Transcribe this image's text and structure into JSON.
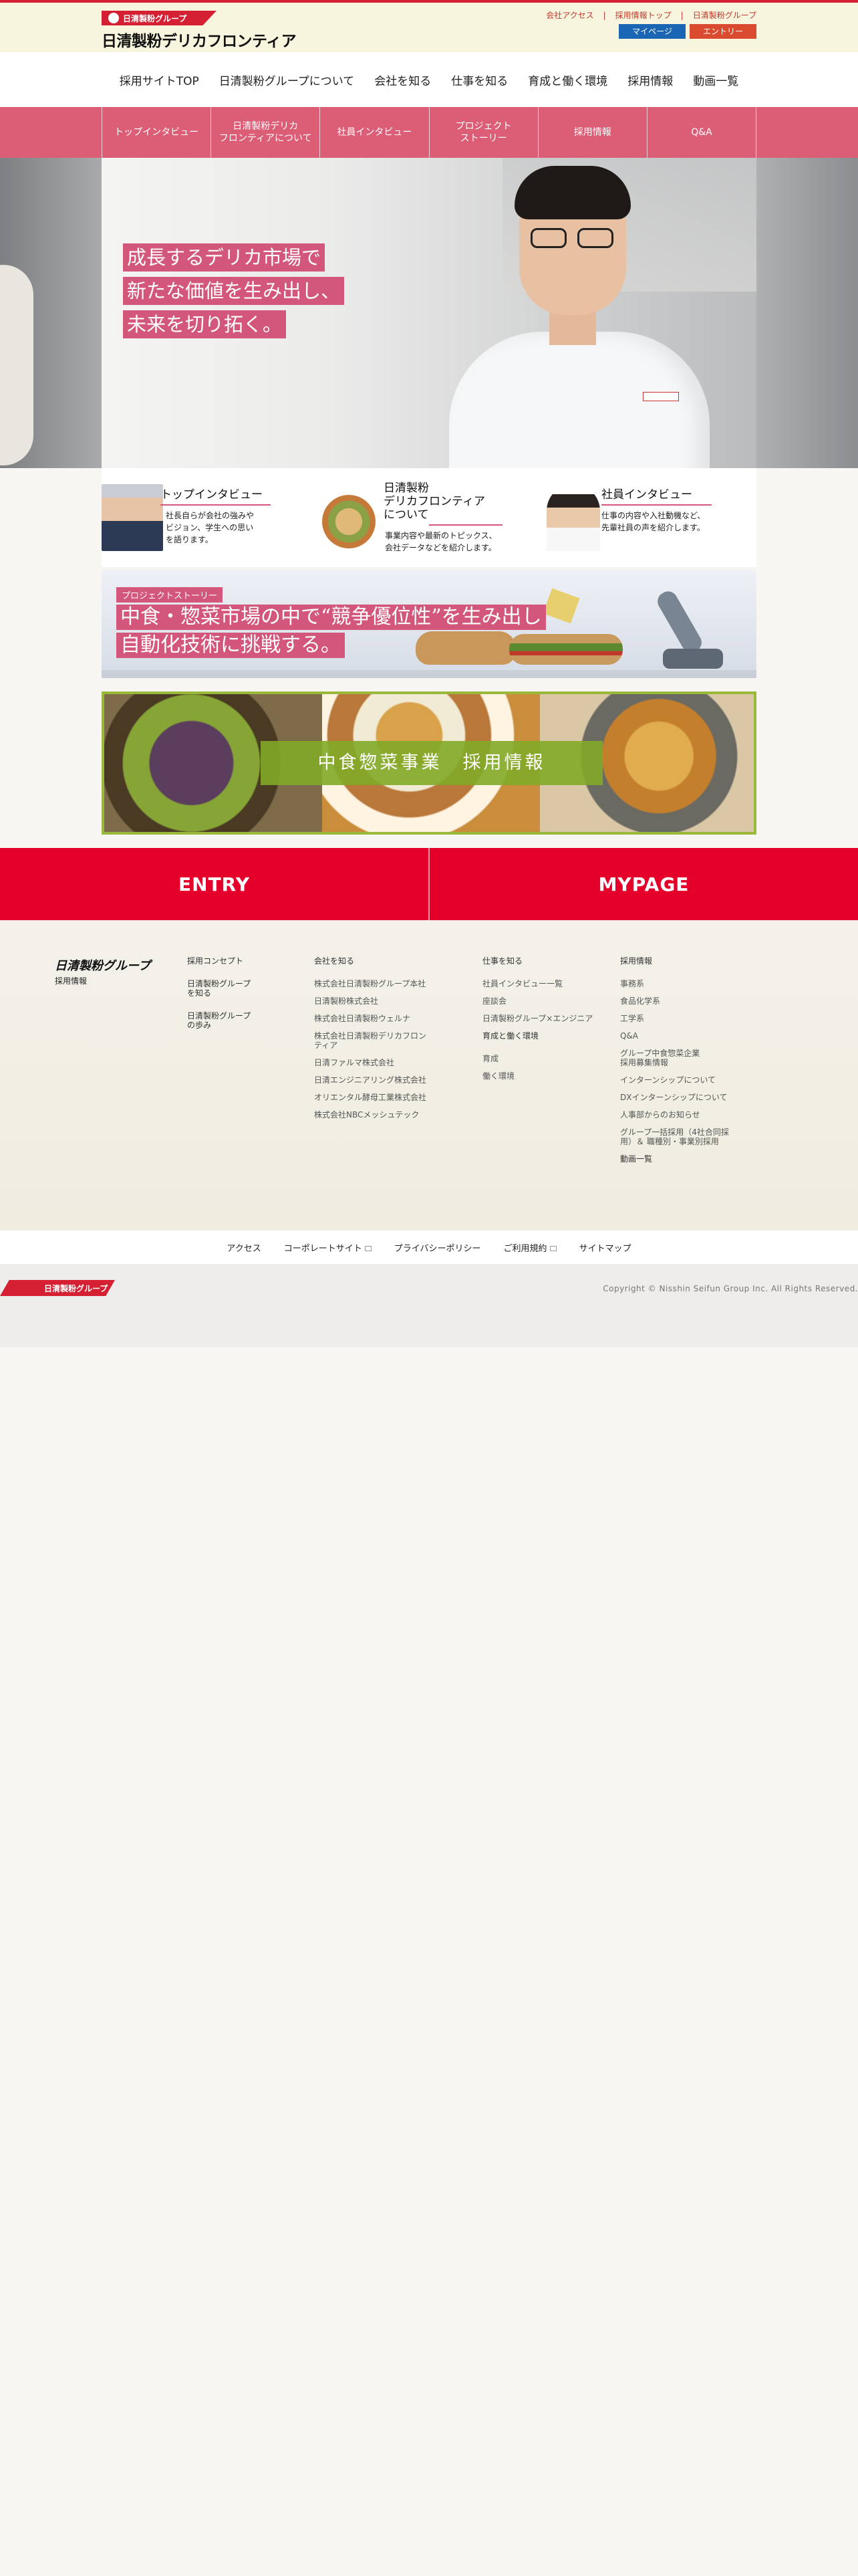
{
  "header": {
    "logo_badge": "日清製粉グループ",
    "logo_main": "日清製粉デリカフロンティア",
    "util_links": [
      "会社アクセス",
      "採用情報トップ",
      "日清製粉グループ"
    ],
    "mypage_btn": "マイページ",
    "entry_btn": "エントリー"
  },
  "gnav": [
    "採用サイトTOP",
    "日清製粉グループについて",
    "会社を知る",
    "仕事を知る",
    "育成と働く環境",
    "採用情報",
    "動画一覧"
  ],
  "subnav": [
    "トップインタビュー",
    "日清製粉デリカ\nフロンティアについて",
    "社員インタビュー",
    "プロジェクト\nストーリー",
    "採用情報",
    "Q&A"
  ],
  "hero": {
    "copy": [
      "成長するデリカ市場で",
      "新たな価値を生み出し、",
      "未来を切り拓く。"
    ]
  },
  "promo": {
    "items": [
      {
        "title": "トップインタビュー",
        "desc": [
          "社長自らが会社の強みや",
          "ビジョン、学生への思い",
          "を語ります。"
        ]
      },
      {
        "title": [
          "日清製粉",
          "デリカフロンティア",
          "について"
        ],
        "desc": [
          "事業内容や最新のトピックス、",
          "会社データなどを紹介します。"
        ]
      },
      {
        "title": "社員インタビュー",
        "desc": [
          "仕事の内容や入社動機など、",
          "先輩社員の声を紹介します。"
        ]
      }
    ]
  },
  "banner": {
    "label": "プロジェクトストーリー",
    "line1": "中食・惣菜市場の中で“競争優位性”を生み出し",
    "line2": "自動化技術に挑戦する。"
  },
  "recruit_banner": "中食惣菜事業　採用情報",
  "cta": {
    "entry": "ENTRY",
    "mypage": "MYPAGE"
  },
  "footer": {
    "logo": "日清製粉グループ",
    "sub": "採用情報",
    "col1": [
      "採用コンセプト",
      "日清製粉グループ\nを知る",
      "日清製粉グループ\nの歩み"
    ],
    "col2_head": "会社を知る",
    "col2": [
      "株式会社日清製粉グループ本社",
      "日清製粉株式会社",
      "株式会社日清製粉ウェルナ",
      "株式会社日清製粉デリカフロンティア",
      "日清ファルマ株式会社",
      "日清エンジニアリング株式会社",
      "オリエンタル酵母工業株式会社",
      "株式会社NBCメッシュテック"
    ],
    "col3_head": "仕事を知る",
    "col3": [
      "社員インタビュー一覧",
      "座談会",
      "日清製粉グループ×エンジニア"
    ],
    "col3b_head": "育成と働く環境",
    "col3b": [
      "育成",
      "働く環境"
    ],
    "col4_head": "採用情報",
    "col4": [
      "事務系",
      "食品化学系",
      "工学系",
      "Q&A",
      "グループ中食惣菜企業\n採用募集情報",
      "インターンシップについて",
      "DXインターンシップについて",
      "人事部からのお知らせ",
      "グループ一括採用（4社合同採用）＆ 職種別・事業別採用"
    ],
    "col4_tail": "動画一覧"
  },
  "bottom_links": [
    "アクセス",
    "コーポレートサイト",
    "プライバシーポリシー",
    "ご利用規約",
    "サイトマップ"
  ],
  "copy": {
    "logo": "日清製粉グループ",
    "text": "Copyright © Nisshin Seifun Group Inc. All Rights Reserved."
  }
}
